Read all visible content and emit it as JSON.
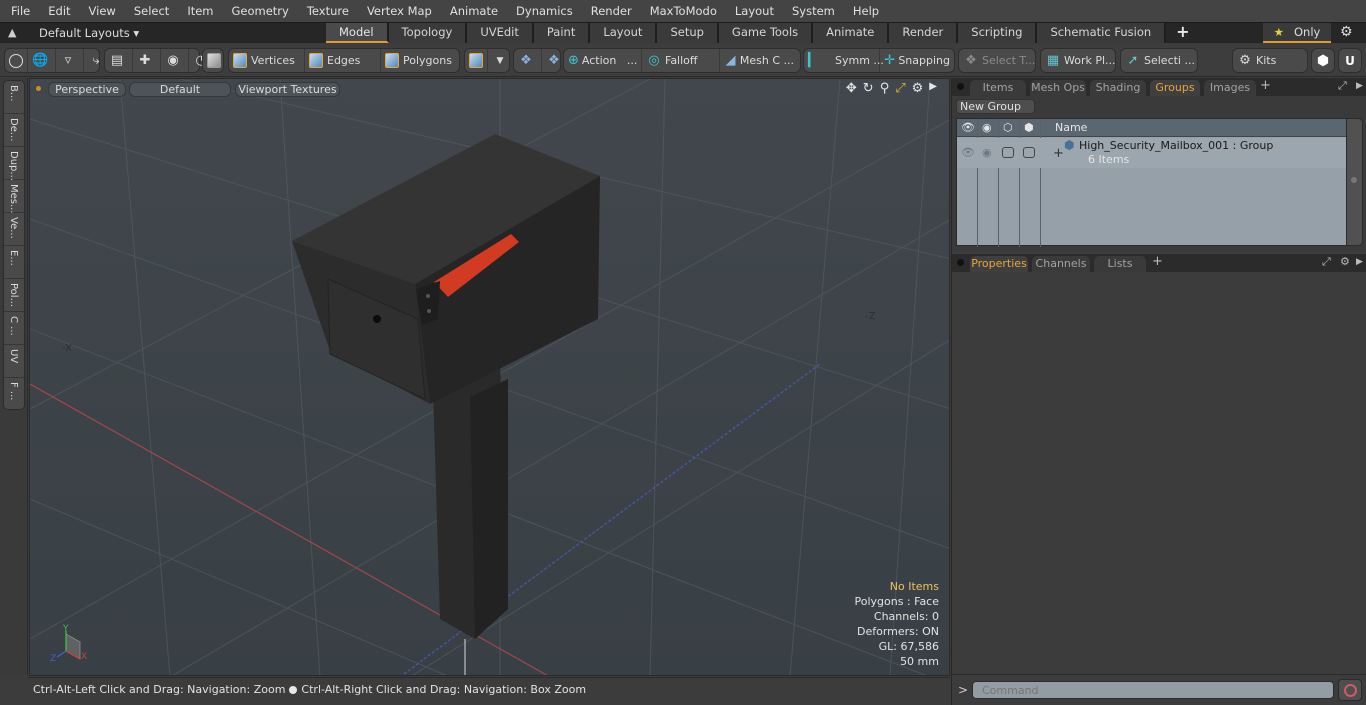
{
  "menubar": {
    "items": [
      "File",
      "Edit",
      "View",
      "Select",
      "Item",
      "Geometry",
      "Texture",
      "Vertex Map",
      "Animate",
      "Dynamics",
      "Render",
      "MaxToModo",
      "Layout",
      "System",
      "Help"
    ]
  },
  "layoutbar": {
    "layouts_label": "Default Layouts",
    "tabs": [
      "Model",
      "Topology",
      "UVEdit",
      "Paint",
      "Layout",
      "Setup",
      "Game Tools",
      "Animate",
      "Render",
      "Scripting",
      "Schematic Fusion"
    ],
    "active_tab": "Model",
    "add_label": "+",
    "only_label": "Only"
  },
  "toolbar": {
    "vertices": "Vertices",
    "edges": "Edges",
    "polygons": "Polygons",
    "action": "Action",
    "action_more": "...",
    "falloff": "Falloff",
    "mesh_c": "Mesh C ...",
    "symm": "Symm ...",
    "snapping": "Snapping",
    "select_t": "Select T...",
    "work_pl": "Work Pl...",
    "selecti": "Selecti ...",
    "kits": "Kits"
  },
  "lefttabs": [
    "B...",
    "De...",
    "Dup...",
    "Mes...",
    "Ve...",
    "E...",
    "Pol...",
    "C ...",
    "UV",
    "F ..."
  ],
  "viewport": {
    "view_mode": "Perspective",
    "shading": "Default",
    "textures": "Viewport Textures",
    "axis_labels": {
      "x": "X",
      "y": "Y",
      "z": "Z",
      "neg_x": "-X",
      "neg_z": "-Z"
    },
    "info": {
      "selection": "No Items",
      "polygons": "Polygons : Face",
      "channels": "Channels: 0",
      "deformers": "Deformers: ON",
      "gl": "GL: 67,586",
      "units": "50 mm"
    },
    "colors": {
      "background": "#3e4449",
      "mailbox": "#262626",
      "flag": "#d23a22",
      "x_axis": "#c84040",
      "z_axis": "#4060d0"
    }
  },
  "statusbar": {
    "hint_left": "Ctrl-Alt-Left Click and Drag: Navigation: Zoom",
    "hint_right": "Ctrl-Alt-Right Click and Drag: Navigation: Box Zoom"
  },
  "groups_panel": {
    "tabs": [
      "Items",
      "Mesh Ops",
      "Shading",
      "Groups",
      "Images"
    ],
    "active_tab": "Groups",
    "new_group_label": "New Group",
    "column_name": "Name",
    "rows": [
      {
        "name": "High_Security_Mailbox_001 : Group",
        "count": "6 Items"
      }
    ]
  },
  "properties_panel": {
    "tabs": [
      "Properties",
      "Channels",
      "Lists"
    ],
    "active_tab": "Properties"
  },
  "command": {
    "prompt": ">",
    "placeholder": "Command"
  },
  "accent_color": "#e39a2f"
}
